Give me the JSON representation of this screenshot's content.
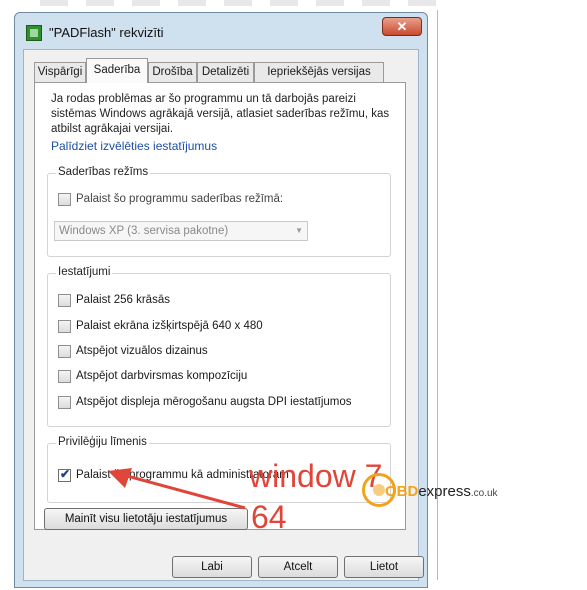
{
  "window": {
    "title": "\"PADFlash\" rekvizīti",
    "close_label": "✕"
  },
  "tabs": [
    {
      "label": "Vispārīgi",
      "active": false
    },
    {
      "label": "Saderība",
      "active": true
    },
    {
      "label": "Drošība",
      "active": false
    },
    {
      "label": "Detalizēti",
      "active": false
    },
    {
      "label": "Iepriekšējās versijas",
      "active": false
    }
  ],
  "panel": {
    "description_lines": [
      "Ja rodas problēmas ar šo programmu un tā darbojās pareizi",
      "sistēmas Windows agrākajā versijā, atlasiet saderības režīmu, kas",
      "atbilst agrākajai versijai."
    ],
    "help_link": "Palīdziet izvēlēties iestatījumus",
    "compat_group": {
      "legend": "Saderības režīms",
      "checkbox_label": "Palaist šo programmu saderības režīmā:",
      "checked": false,
      "select_value": "Windows XP (3. servisa pakotne)"
    },
    "settings_group": {
      "legend": "Iestatījumi",
      "items": [
        {
          "label": "Palaist 256 krāsās",
          "checked": false
        },
        {
          "label": "Palaist ekrāna izšķirtspējā 640 x 480",
          "checked": false
        },
        {
          "label": "Atspējot vizuālos dizainus",
          "checked": false
        },
        {
          "label": "Atspējot darbvirsmas kompozīciju",
          "checked": false
        },
        {
          "label": "Atspējot displeja mērogošanu augsta DPI iestatījumos",
          "checked": false
        }
      ]
    },
    "privilege_group": {
      "legend": "Privilēģiju līmenis",
      "admin_label": "Palaist šo programmu kā administratoram",
      "admin_checked": true
    }
  },
  "buttons": {
    "change_all_users": "Mainīt visu lietotāju iestatījumus",
    "ok": "Labi",
    "cancel": "Atcelt",
    "apply": "Lietot"
  },
  "annotation": {
    "line1": "window 7",
    "line2": "64",
    "color": "#e0453a"
  },
  "watermark": {
    "accent": "OBD",
    "main": "express",
    "tld": ".co.uk",
    "accent_color": "#f2a31a"
  }
}
